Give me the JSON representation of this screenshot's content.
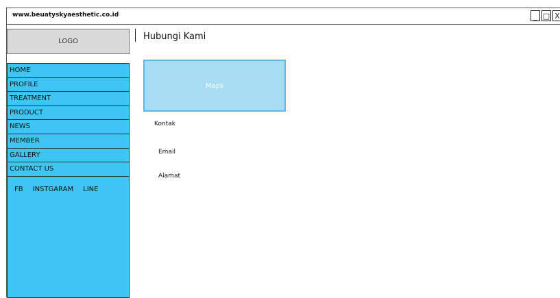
{
  "window": {
    "url": "www.beuatyskyaesthetic.co.id",
    "controls": [
      "_",
      "□",
      "X"
    ]
  },
  "header": {
    "logo": "LOGO",
    "title": "Hubungi Kami"
  },
  "sidebar": {
    "items": [
      {
        "label": "HOME"
      },
      {
        "label": "PROFILE"
      },
      {
        "label": "TREATMENT"
      },
      {
        "label": "PRODUCT"
      },
      {
        "label": "NEWS"
      },
      {
        "label": "MEMBER"
      },
      {
        "label": "GALLERY"
      },
      {
        "label": "CONTACT US"
      }
    ],
    "social": [
      "FB",
      "INSTGARAM",
      "LINE"
    ]
  },
  "content": {
    "maps_label": "Maps",
    "contact_label": "Kontak",
    "email_label": "Email",
    "address_label": "Alamat"
  },
  "colors": {
    "sidebar_bg": "#3ec6f2",
    "maps_bg": "#a8dcf3",
    "logo_bg": "#dadada"
  }
}
